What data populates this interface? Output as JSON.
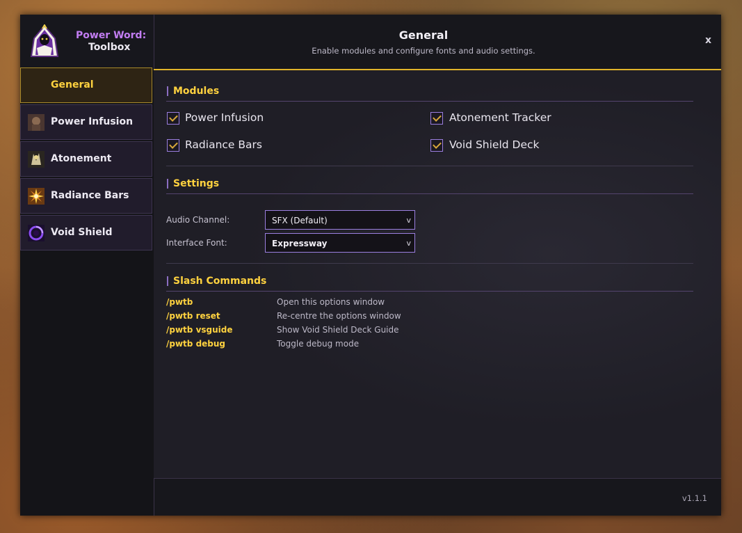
{
  "brand": {
    "line1": "Power Word:",
    "line2": "Toolbox"
  },
  "nav": [
    {
      "label": "General",
      "active": true
    },
    {
      "label": "Power Infusion",
      "active": false
    },
    {
      "label": "Atonement",
      "active": false
    },
    {
      "label": "Radiance Bars",
      "active": false
    },
    {
      "label": "Void Shield",
      "active": false
    }
  ],
  "header": {
    "title": "General",
    "subtitle": "Enable modules and configure fonts and audio settings.",
    "close_label": "x"
  },
  "modules": {
    "title": "Modules",
    "items": [
      {
        "label": "Power Infusion",
        "checked": true
      },
      {
        "label": "Atonement Tracker",
        "checked": true
      },
      {
        "label": "Radiance Bars",
        "checked": true
      },
      {
        "label": "Void Shield Deck",
        "checked": true
      }
    ]
  },
  "settings": {
    "title": "Settings",
    "audio_label": "Audio Channel:",
    "audio_value": "SFX (Default)",
    "font_label": "Interface Font:",
    "font_value": "Expressway",
    "dropdown_arrow": "v"
  },
  "commands": {
    "title": "Slash Commands",
    "items": [
      {
        "cmd": "/pwtb",
        "desc": "Open this options window"
      },
      {
        "cmd": "/pwtb reset",
        "desc": "Re-centre the options window"
      },
      {
        "cmd": "/pwtb vsguide",
        "desc": "Show Void Shield Deck Guide"
      },
      {
        "cmd": "/pwtb debug",
        "desc": "Toggle debug mode"
      }
    ]
  },
  "version": "v1.1.1",
  "colors": {
    "accent_gold": "#ffd23f",
    "accent_purple": "#9b7fe0",
    "brand_purple": "#c27df2"
  }
}
